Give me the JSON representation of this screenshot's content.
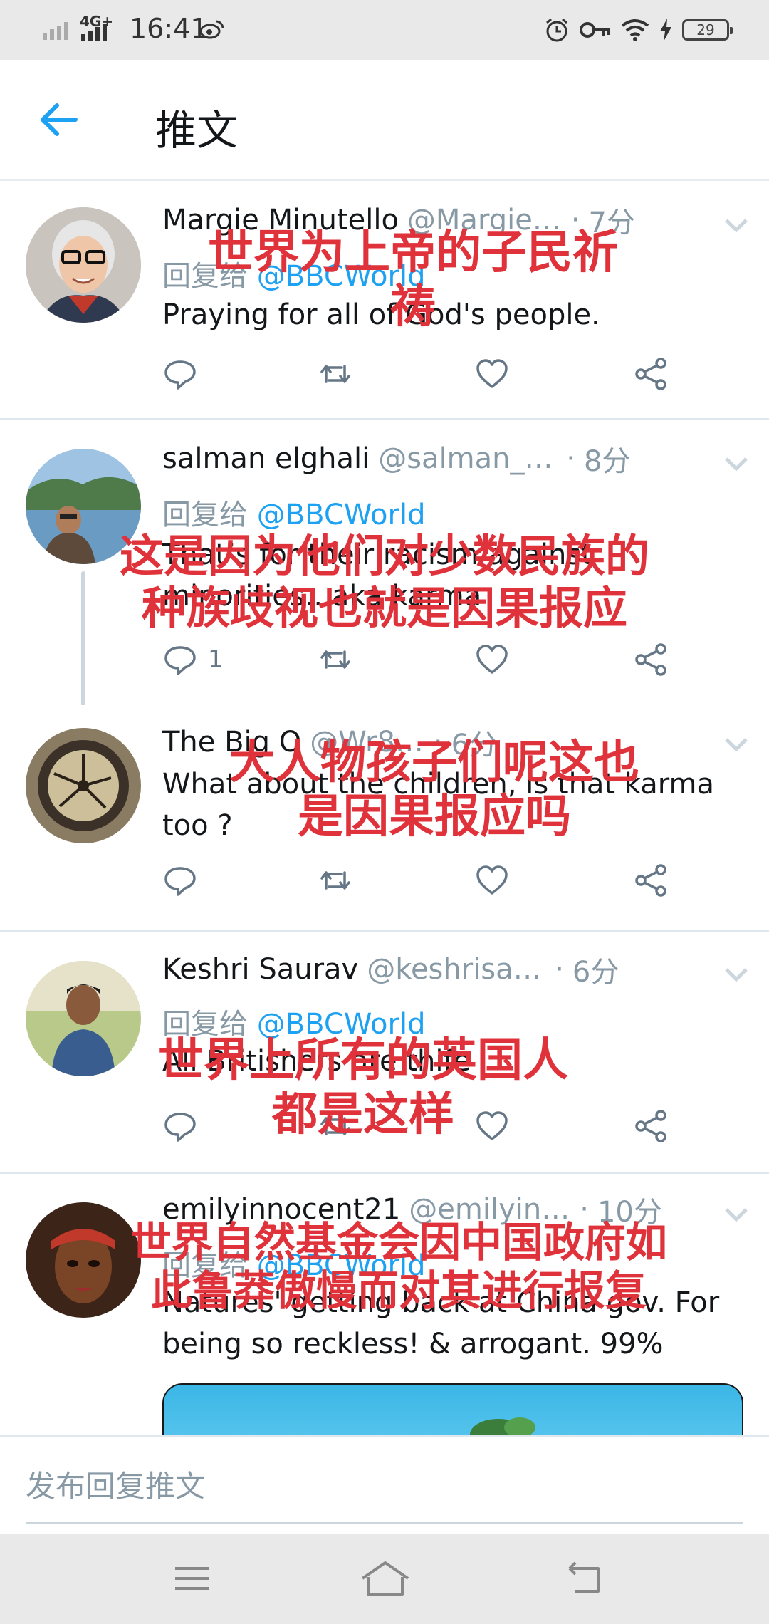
{
  "status_bar": {
    "network": "4G+",
    "time": "16:41",
    "battery": "29",
    "icons": [
      "signal-icon",
      "signal-4g-icon",
      "weibo-icon",
      "alarm-icon",
      "key-icon",
      "wifi-icon",
      "charging-icon",
      "battery-icon"
    ]
  },
  "header": {
    "title": "推文",
    "back_icon": "back-arrow-icon"
  },
  "tweets": [
    {
      "name": "Margie Minutello",
      "handle": "@Margie…",
      "time": "7分",
      "reply_prefix": "回复给",
      "reply_to": "@BBCWorld",
      "text": "Praying for all of God's people.",
      "reply_count": "",
      "caption": "世界为上帝的子民祈\n祷"
    },
    {
      "name": "salman elghali",
      "handle": "@salman_el…",
      "time": "8分",
      "reply_prefix": "回复给",
      "reply_to": "@BBCWorld",
      "text": "That’s for their racism against minorities.. aka karma",
      "reply_count": "1",
      "caption": "这是因为他们对少数民族的\n种族歧视也就是因果报应"
    },
    {
      "name": "The Big O",
      "handle": "@Wr8…",
      "time": "6分",
      "text": "What about the children, is that karma too ?",
      "reply_count": "",
      "caption": "大人物孩子们呢这也\n是因果报应吗"
    },
    {
      "name": "Keshri Saurav",
      "handle": "@keshrisaur…",
      "time": "6分",
      "reply_prefix": "回复给",
      "reply_to": "@BBCWorld",
      "text": "All Britishers are thife",
      "reply_count": "",
      "caption": "世界上所有的英国人\n都是这样"
    },
    {
      "name": "emilyinnocent21",
      "handle": "@emilyin…",
      "time": "10分",
      "reply_prefix": "回复给",
      "reply_to": "@BBCWorld",
      "text": "Natures' getting back at China gov. For being so reckless! & arrogant. 99%",
      "reply_count": "",
      "caption": "世界自然基金会因中国政府如\n此鲁莽傲慢而对其进行报复"
    }
  ],
  "compose": {
    "placeholder": "发布回复推文"
  },
  "nav_bar": {
    "icons": [
      "menu-icon",
      "home-icon",
      "back-icon"
    ]
  },
  "colors": {
    "accent": "#1da1f2",
    "caption": "#e0323a",
    "muted": "#8899a6"
  }
}
